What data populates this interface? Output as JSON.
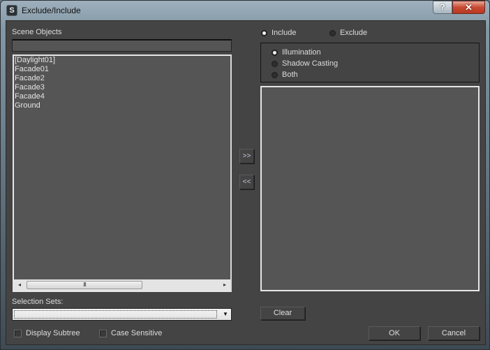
{
  "window": {
    "title": "Exclude/Include",
    "app_icon": "3ds-max-icon",
    "help_button": "?",
    "close_button": "✕"
  },
  "left": {
    "scene_objects_label": "Scene Objects",
    "search_value": "",
    "objects": [
      "[Daylight01]",
      "Facade01",
      "Facade2",
      "Facade3",
      "Facade4",
      "Ground"
    ],
    "scroll": {
      "left_arrow": "◂",
      "right_arrow": "▸",
      "thumb_grip": "III"
    },
    "selection_sets_label": "Selection Sets:",
    "selection_sets_value": "",
    "dropdown_arrow": "▼",
    "display_subtree_label": "Display Subtree",
    "display_subtree_checked": false,
    "case_sensitive_label": "Case Sensitive",
    "case_sensitive_checked": false
  },
  "middle": {
    "add_button": ">>",
    "remove_button": "<<"
  },
  "right": {
    "mode": {
      "include_label": "Include",
      "exclude_label": "Exclude",
      "selected": "Include"
    },
    "type": {
      "options": [
        "Illumination",
        "Shadow Casting",
        "Both"
      ],
      "selected": "Illumination"
    },
    "included_objects": [],
    "clear_button": "Clear"
  },
  "footer": {
    "ok_button": "OK",
    "cancel_button": "Cancel"
  }
}
